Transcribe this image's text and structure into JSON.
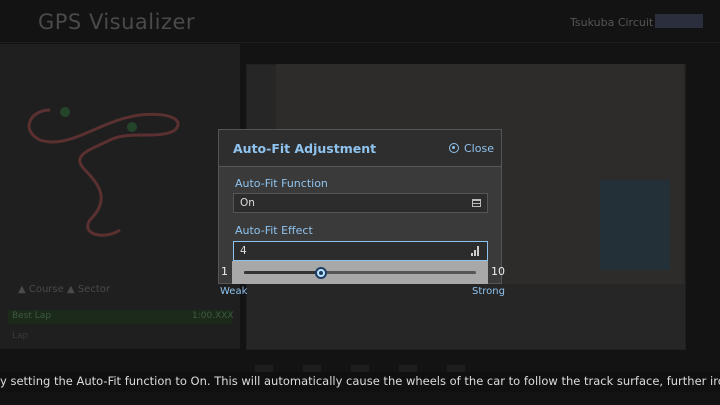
{
  "app": {
    "title": "GPS Visualizer",
    "course": "Tsukuba Circuit"
  },
  "background": {
    "legend": "▲ Course   ▲ Sector",
    "lap_label": "Best Lap",
    "lap_time": "1:00.XXX",
    "lap_label2": "Lap"
  },
  "dialog": {
    "title": "Auto-Fit Adjustment",
    "close_label": "Close",
    "function": {
      "label": "Auto-Fit Function",
      "value": "On"
    },
    "effect": {
      "label": "Auto-Fit Effect",
      "value": "4",
      "slider_min": "1",
      "slider_max": "10",
      "slider_value": 4,
      "min_caption": "Weak",
      "max_caption": "Strong"
    }
  },
  "help_text": "y setting the Auto-Fit function to On. This will automatically cause the wheels of the car to follow the track surface, further ironing ou",
  "colors": {
    "accent": "#8fc3ef",
    "dialog_bg": "#3a3a3a",
    "slider_bg": "#a8a8a8"
  }
}
